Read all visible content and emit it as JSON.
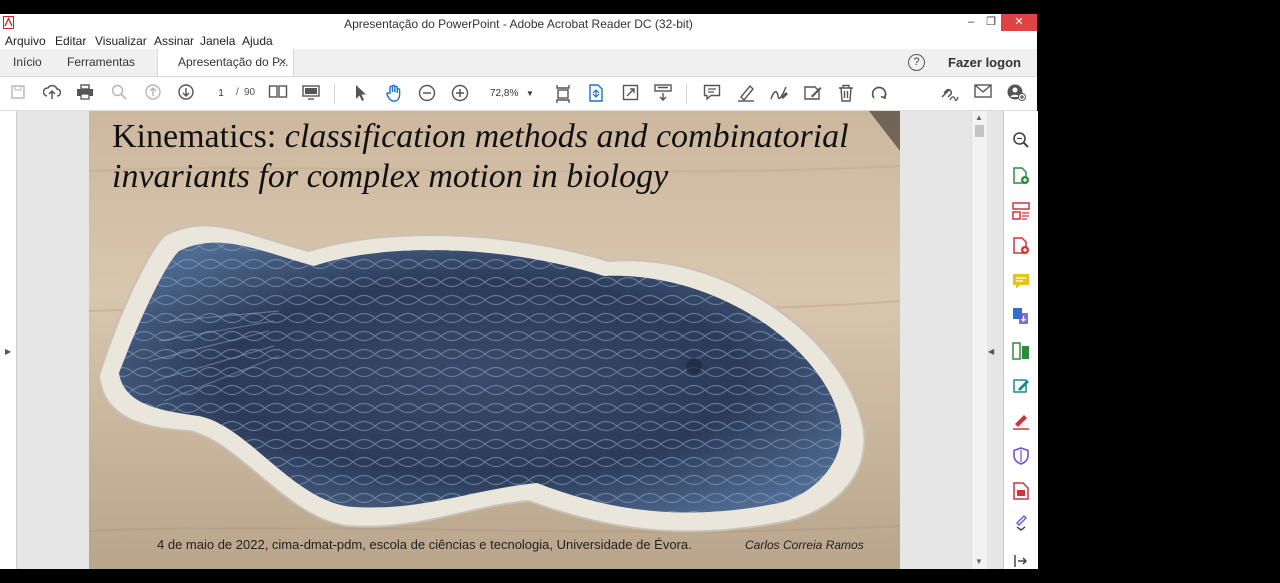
{
  "window": {
    "title": "Apresentação do PowerPoint - Adobe Acrobat Reader DC (32-bit)",
    "minimize": "–",
    "restore": "❐",
    "close": "✕"
  },
  "menu": [
    "Arquivo",
    "Editar",
    "Visualizar",
    "Assinar",
    "Janela",
    "Ajuda"
  ],
  "tabs": {
    "home": "Início",
    "tools": "Ferramentas",
    "document": "Apresentação do P...",
    "close": "×",
    "help": "?",
    "login": "Fazer logon"
  },
  "toolbar": {
    "page_current": "1",
    "page_sep": "/",
    "page_total": "90",
    "zoom": "72,8%"
  },
  "slide": {
    "title_plain": "Kinematics:",
    "title_italic": " classification methods and combinatorial",
    "title_line2": "invariants for complex motion in biology",
    "footer": "4 de maio de 2022,  cima-dmat-pdm, escola de ciências e tecnologia, Universidade de Évora.",
    "author": "Carlos Correia Ramos"
  },
  "colors": {
    "accent": "#1a73c8",
    "close_button": "#e04343",
    "rp_green": "#2e8b3e",
    "rp_red": "#d0343a",
    "rp_yellow": "#e6c21a",
    "rp_purple": "#6e56cf",
    "rp_blue": "#2c6fd0"
  }
}
